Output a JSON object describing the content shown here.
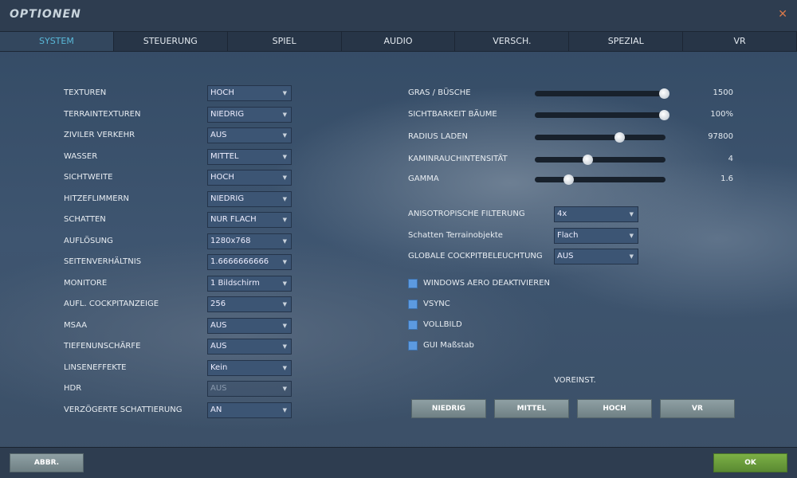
{
  "window": {
    "title": "OPTIONEN",
    "close_icon": "close-icon"
  },
  "tabs": [
    "SYSTEM",
    "STEUERUNG",
    "SPIEL",
    "AUDIO",
    "VERSCH.",
    "SPEZIAL",
    "VR"
  ],
  "active_tab": "SYSTEM",
  "left_settings": [
    {
      "label": "TEXTUREN",
      "value": "HOCH"
    },
    {
      "label": "TERRAINTEXTUREN",
      "value": "NIEDRIG"
    },
    {
      "label": "ZIVILER VERKEHR",
      "value": "AUS"
    },
    {
      "label": "WASSER",
      "value": "MITTEL"
    },
    {
      "label": "SICHTWEITE",
      "value": "HOCH"
    },
    {
      "label": "HITZEFLIMMERN",
      "value": "NIEDRIG"
    },
    {
      "label": "SCHATTEN",
      "value": "NUR FLACH"
    },
    {
      "label": "AUFLÖSUNG",
      "value": "1280x768"
    },
    {
      "label": "SEITENVERHÄLTNIS",
      "value": "1.6666666666"
    },
    {
      "label": "MONITORE",
      "value": "1 Bildschirm"
    },
    {
      "label": "AUFL. COCKPITANZEIGE",
      "value": "256"
    },
    {
      "label": "MSAA",
      "value": "AUS"
    },
    {
      "label": "TIEFENUNSCHÄRFE",
      "value": "AUS"
    },
    {
      "label": "LINSENEFFEKTE",
      "value": "Kein"
    },
    {
      "label": "HDR",
      "value": "AUS",
      "disabled": true
    },
    {
      "label": "VERZÖGERTE SCHATTIERUNG",
      "value": "AN"
    }
  ],
  "sliders": [
    {
      "label": "GRAS / BÜSCHE",
      "value": "1500",
      "fraction": 1.0
    },
    {
      "label": "SICHTBARKEIT BÄUME",
      "value": "100%",
      "fraction": 1.0
    },
    {
      "label": "RADIUS LADEN",
      "value": "97800",
      "fraction": 0.65
    },
    {
      "label": "KAMINRAUCHINTENSITÄT",
      "value": "4",
      "fraction": 0.4
    },
    {
      "label": "GAMMA",
      "value": "1.6",
      "fraction": 0.25
    }
  ],
  "right_dropdowns": [
    {
      "label": "ANISOTROPISCHE FILTERUNG",
      "value": "4x"
    },
    {
      "label": "Schatten Terrainobjekte",
      "value": "Flach"
    },
    {
      "label": "GLOBALE COCKPITBELEUCHTUNG",
      "value": "AUS"
    }
  ],
  "checkboxes": [
    {
      "label": "WINDOWS AERO DEAKTIVIEREN",
      "checked": false
    },
    {
      "label": "VSYNC",
      "checked": false
    },
    {
      "label": "VOLLBILD",
      "checked": false
    },
    {
      "label": "GUI Maßstab",
      "checked": false
    }
  ],
  "presets": {
    "label": "VOREINST.",
    "buttons": [
      "NIEDRIG",
      "MITTEL",
      "HOCH",
      "VR"
    ]
  },
  "footer": {
    "cancel": "ABBR.",
    "ok": "OK"
  },
  "colors": {
    "active_tab": "#59b8d8",
    "ok_button": "#6a9c3c",
    "checkbox": "#5c9ae0",
    "close": "#d9794a"
  }
}
